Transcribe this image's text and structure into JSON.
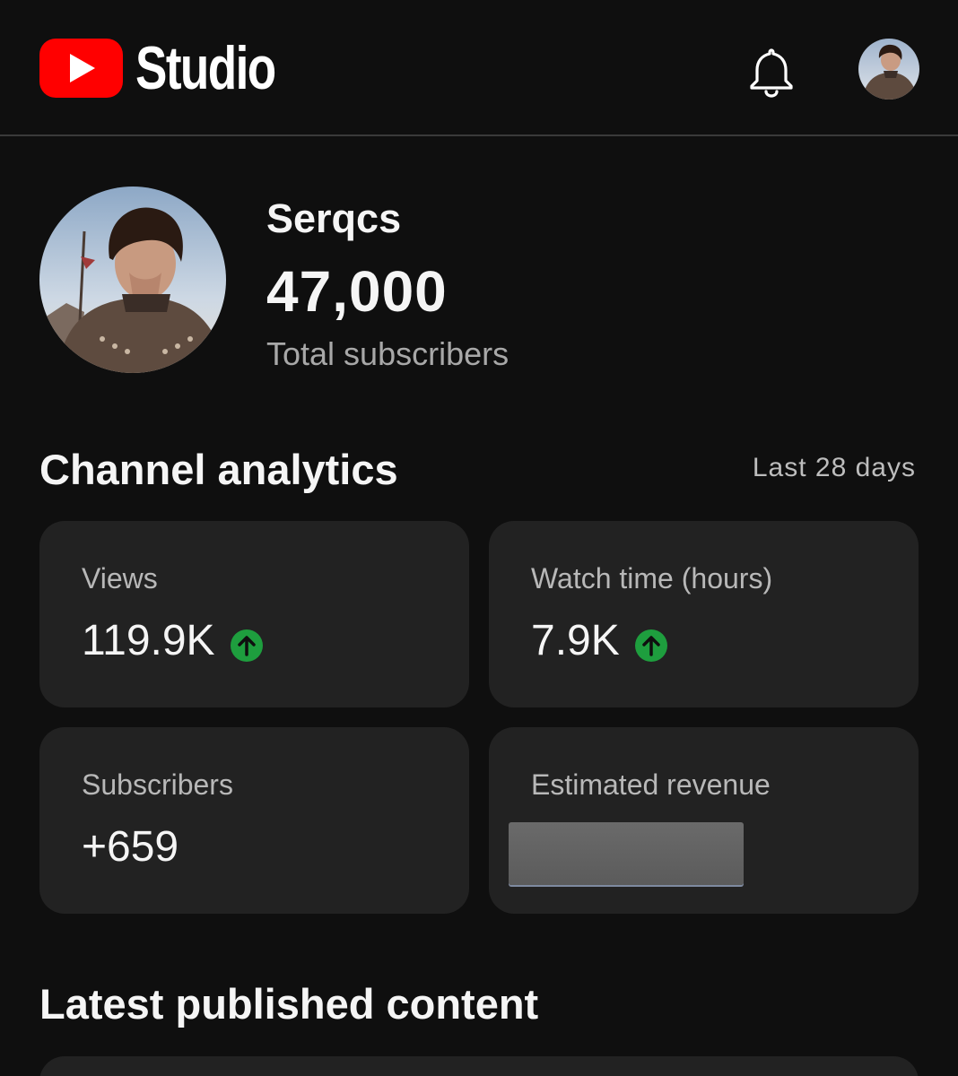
{
  "header": {
    "logo_text": "Studio",
    "colors": {
      "brand_red": "#ff0000"
    },
    "icons": {
      "logo": "youtube-play-icon",
      "notifications": "bell-icon",
      "account": "avatar"
    }
  },
  "channel": {
    "name": "Serqcs",
    "subscriber_count": "47,000",
    "subscriber_label": "Total subscribers"
  },
  "analytics": {
    "title": "Channel analytics",
    "range": "Last 28 days",
    "colors": {
      "trend_up": "#1e9e3e"
    },
    "cards": [
      {
        "label": "Views",
        "value": "119.9K",
        "trend": "up"
      },
      {
        "label": "Watch time (hours)",
        "value": "7.9K",
        "trend": "up"
      },
      {
        "label": "Subscribers",
        "value": "+659"
      },
      {
        "label": "Estimated revenue",
        "value": ""
      }
    ]
  },
  "latest": {
    "title": "Latest published content"
  }
}
